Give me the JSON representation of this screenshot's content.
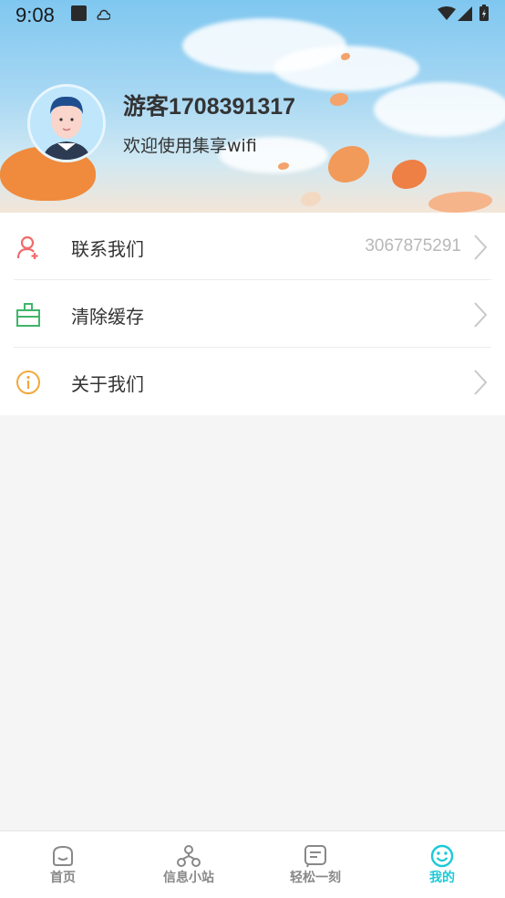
{
  "status_bar": {
    "time": "9:08"
  },
  "profile": {
    "username": "游客1708391317",
    "welcome": "欢迎使用集享wifi"
  },
  "menu": {
    "items": [
      {
        "label": "联系我们",
        "value": "3067875291",
        "icon": "contact-person-add-icon",
        "icon_color": "#f06b6b"
      },
      {
        "label": "清除缓存",
        "value": "",
        "icon": "broom-clean-icon",
        "icon_color": "#3fb56a"
      },
      {
        "label": "关于我们",
        "value": "",
        "icon": "info-circle-icon",
        "icon_color": "#f2a93b"
      }
    ]
  },
  "tabbar": {
    "active_color": "#1cc9d8",
    "inactive_color": "#888888",
    "tabs": [
      {
        "label": "首页",
        "icon": "home-face-icon",
        "active": false
      },
      {
        "label": "信息小站",
        "icon": "network-nodes-icon",
        "active": false
      },
      {
        "label": "轻松一刻",
        "icon": "message-square-icon",
        "active": false
      },
      {
        "label": "我的",
        "icon": "smiley-icon",
        "active": true
      }
    ]
  }
}
